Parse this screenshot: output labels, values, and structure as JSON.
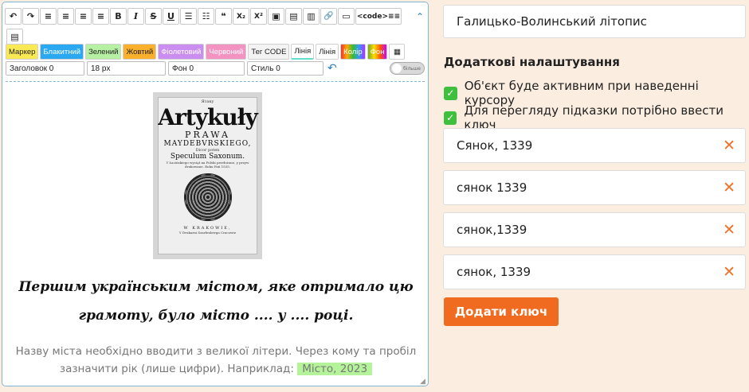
{
  "editor": {
    "toolbar_row1": [
      "↶",
      "↷",
      "≡",
      "≡",
      "≡",
      "≡",
      "B",
      "I",
      "S",
      "U",
      "☰",
      "☷",
      "❝",
      "X₂",
      "X²",
      "▣",
      "▤",
      "▥",
      "🔗",
      "▭",
      "<code>≡≡"
    ],
    "toolbar_row2": [
      "▤"
    ],
    "style_buttons": {
      "marker": "Маркер",
      "blue": "Блакитний",
      "green": "Зелений",
      "yellow": "Жовтий",
      "violet": "Фіолетовий",
      "red": "Червоний",
      "tag_code": "Тег CODE",
      "line1": "Лінія",
      "line2": "Лінія",
      "color": "Колір",
      "fon": "Фон"
    },
    "selects": {
      "heading": "Заголовок 0",
      "size": "18 px",
      "bg": "Фон 0",
      "style": "Стиль 0"
    },
    "toggle_label": "більше",
    "question": "Першим українським містом, яке отримало цю грамоту, було місто .... у .... році.",
    "hint_text": "Назву міста необхідно вводити з великої літери. Через кому та пробіл зазначити рік (лише цифри). Наприклад:",
    "hint_example": "Місто, 2023",
    "book": {
      "top_line": "Ятаку",
      "title": "Artykuły",
      "line1": "PRAWA",
      "line2": "MAYDEBVRSKIEGO,",
      "line3": "Dicor poten",
      "line4": "Speculum Saxonum.",
      "small": "Y Łacińskiego wycięt na Polski przełożone, y przyw drukowane. Roku Pań 1535.",
      "city": "W KRAKOWIE,",
      "bottom": "Y Drukarni Szarfenberga Cracowie"
    }
  },
  "panel": {
    "title_value": "Галицько-Волинський літопис",
    "settings_heading": "Додаткові налаштування",
    "checks": [
      "Об'єкт буде активним при наведенні курсору",
      "Для перегляду підказки потрібно ввести ключ"
    ],
    "keys": [
      "Сянок, 1339",
      "сянок 1339",
      "сянок,1339",
      "сянок, 1339"
    ],
    "add_key_label": "Додати ключ"
  },
  "colors": {
    "accent": "#f06b1f",
    "check": "#3ebf3e",
    "border": "#7fb6d6",
    "page_bg": "#fbeee1"
  }
}
